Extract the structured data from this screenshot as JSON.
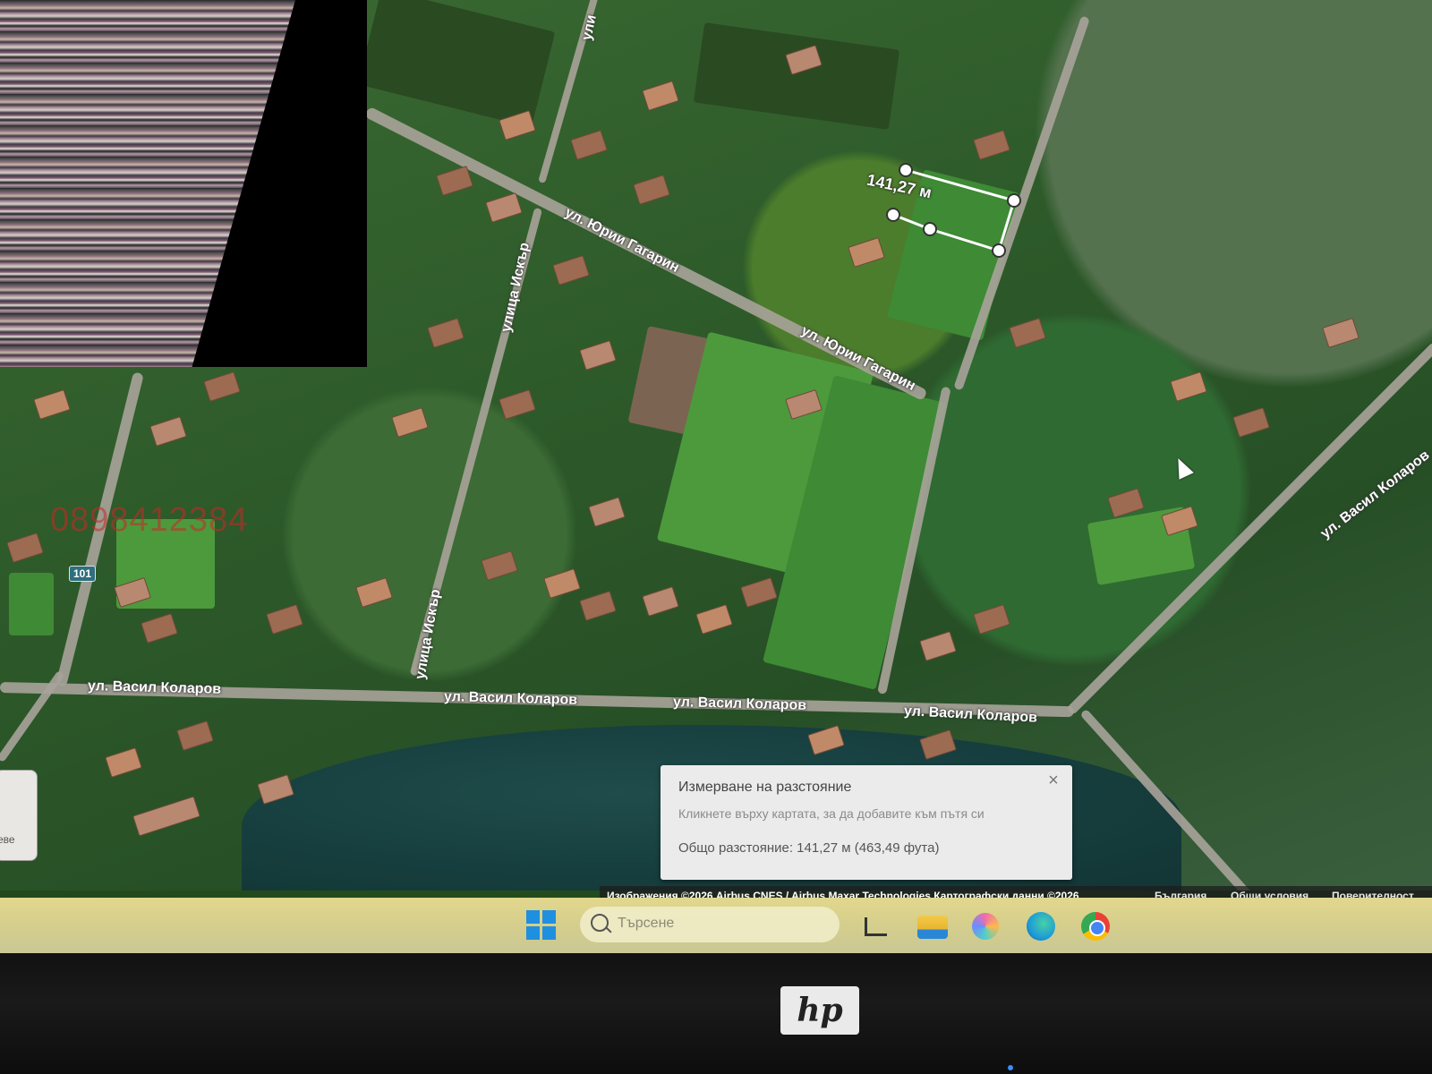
{
  "map": {
    "street_labels": [
      {
        "id": "yuri-gagarin-1",
        "text": "ул. Юрии Гагарин"
      },
      {
        "id": "yuri-gagarin-2",
        "text": "ул. Юрии Гагарин"
      },
      {
        "id": "iskar-1",
        "text": "улица Искър"
      },
      {
        "id": "iskar-2",
        "text": "улица Искър"
      },
      {
        "id": "vasil-kolarov-1",
        "text": "ул. Васил Коларов"
      },
      {
        "id": "vasil-kolarov-2",
        "text": "ул. Васил Коларов"
      },
      {
        "id": "vasil-kolarov-3",
        "text": "ул. Васил Коларов"
      },
      {
        "id": "vasil-kolarov-4",
        "text": "ул. Васил Коларов"
      },
      {
        "id": "vasil-kolarov-5",
        "text": "ул. Васил Коларов"
      },
      {
        "id": "top-partial",
        "text": "ули"
      }
    ],
    "route_shield": "101",
    "watermark_phone": "0898412384",
    "measure_line_label": "141,27 м",
    "left_edge_text": "еве"
  },
  "measure_panel": {
    "title": "Измерване на разстояние",
    "hint": "Кликнете върху картата, за да добавите към пътя си",
    "total": "Общо разстояние: 141,27 м (463,49 фута)",
    "close_icon": "close-icon"
  },
  "attribution": {
    "text": "Изображения ©2026 Airbus,CNES / Airbus,Maxar Technologies,Картографски данни ©2026",
    "country": "България",
    "terms": "Общи условия",
    "privacy": "Поверителност"
  },
  "taskbar": {
    "search_placeholder": "Търсене",
    "icons": [
      "windows-start-icon",
      "search-icon",
      "task-view-icon",
      "file-explorer-icon",
      "copilot-icon",
      "edge-icon",
      "chrome-icon"
    ]
  },
  "monitor": {
    "brand": "hp"
  },
  "colors": {
    "start_blue": "#1f8fe0",
    "measure_panel_bg": "#ecebeb",
    "taskbar_tint": "#d5ce8c"
  }
}
